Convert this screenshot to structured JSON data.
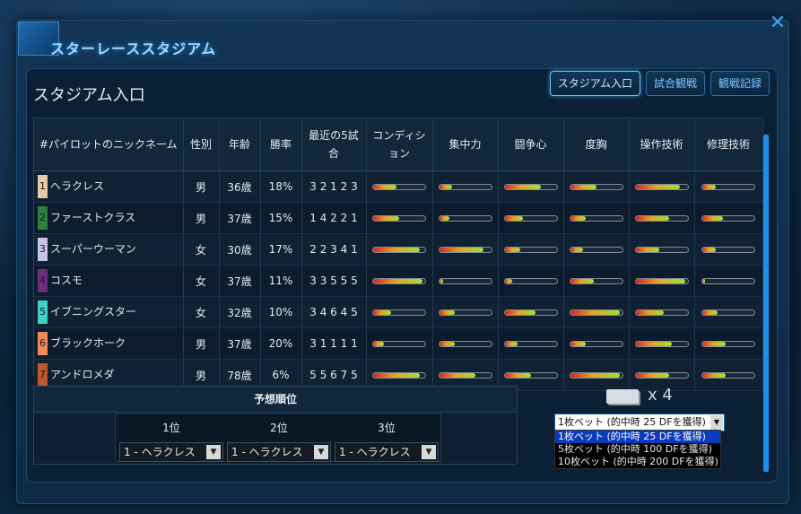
{
  "app": {
    "title": "スターレーススタジアム"
  },
  "section": {
    "title": "スタジアム入口"
  },
  "tabs": [
    {
      "label": "スタジアム入口",
      "active": true
    },
    {
      "label": "試合観戦",
      "active": false
    },
    {
      "label": "観戦記録",
      "active": false
    }
  ],
  "table": {
    "headers": [
      "#パイロットのニックネーム",
      "性別",
      "年齢",
      "勝率",
      "最近の5試合",
      "コンディション",
      "集中力",
      "闘争心",
      "度胸",
      "操作技術",
      "修理技術"
    ],
    "rows": [
      {
        "no": "1",
        "name": "ヘラクレス",
        "gender": "男",
        "age": "36歳",
        "win": "18%",
        "recent": "3 2 1 2 3",
        "color": "#e8c9a5",
        "stats": [
          0.45,
          0.25,
          0.7,
          0.5,
          0.85,
          0.25
        ]
      },
      {
        "no": "2",
        "name": "ファーストクラス",
        "gender": "男",
        "age": "37歳",
        "win": "15%",
        "recent": "1 4 2 2 1",
        "color": "#2f7f3f",
        "stats": [
          0.5,
          0.2,
          0.35,
          0.3,
          0.65,
          0.4
        ]
      },
      {
        "no": "3",
        "name": "スーパーウーマン",
        "gender": "女",
        "age": "30歳",
        "win": "17%",
        "recent": "2 2 3 4 1",
        "color": "#c9c5e8",
        "stats": [
          0.9,
          0.85,
          0.3,
          0.25,
          0.45,
          0.25
        ]
      },
      {
        "no": "4",
        "name": "コスモ",
        "gender": "女",
        "age": "37歳",
        "win": "11%",
        "recent": "3 3 5 5 5",
        "color": "#6b2f7a",
        "stats": [
          0.95,
          0.08,
          0.15,
          0.45,
          0.95,
          0.05
        ]
      },
      {
        "no": "5",
        "name": "イブニングスター",
        "gender": "女",
        "age": "32歳",
        "win": "10%",
        "recent": "3 4 6 4 5",
        "color": "#3ad1c6",
        "stats": [
          0.35,
          0.3,
          0.6,
          0.95,
          0.55,
          0.3
        ]
      },
      {
        "no": "6",
        "name": "ブラックホーク",
        "gender": "男",
        "age": "37歳",
        "win": "20%",
        "recent": "3 1 1 1 1",
        "color": "#f08a5d",
        "stats": [
          0.2,
          0.3,
          0.25,
          0.3,
          0.7,
          0.45
        ]
      },
      {
        "no": "7",
        "name": "アンドロメダ",
        "gender": "男",
        "age": "78歳",
        "win": "6%",
        "recent": "5 5 6 7 5",
        "color": "#c0572c",
        "stats": [
          0.9,
          0.7,
          0.5,
          0.95,
          0.65,
          0.45
        ]
      }
    ]
  },
  "prediction": {
    "title": "予想順位",
    "ranks": [
      {
        "label": "1位",
        "value": "1 - ヘラクレス"
      },
      {
        "label": "2位",
        "value": "1 - ヘラクレス"
      },
      {
        "label": "3位",
        "value": "1 - ヘラクレス"
      }
    ]
  },
  "tickets": {
    "count": "x 4"
  },
  "bet": {
    "selected": "1枚ベット (的中時 25 DFを獲得)",
    "options": [
      "1枚ベット (的中時 25 DFを獲得)",
      "5枚ベット (的中時 100 DFを獲得)",
      "10枚ベット (的中時 200 DFを獲得)"
    ]
  },
  "icons": {
    "close": "close-icon",
    "ticket": "ticket-icon",
    "dropdown": "chevron-down-icon"
  }
}
